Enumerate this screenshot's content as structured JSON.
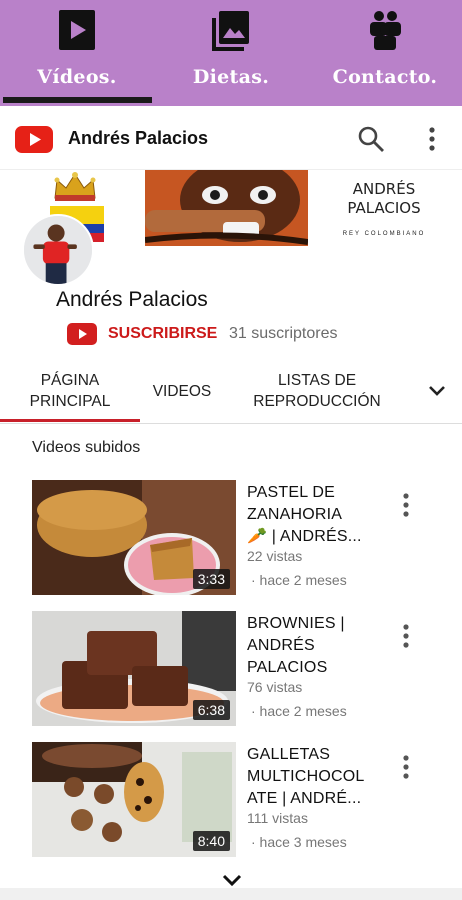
{
  "app_tabs": [
    {
      "label": "Vídeos.",
      "icon": "play-icon",
      "selected": true
    },
    {
      "label": "Dietas.",
      "icon": "image-gallery-icon",
      "selected": false
    },
    {
      "label": "Contacto.",
      "icon": "people-icon",
      "selected": false
    }
  ],
  "youtube_header": {
    "logo": "youtube-logo-icon",
    "title": "Andrés Palacios",
    "search_icon": "search-icon",
    "menu_icon": "more-vert-icon"
  },
  "banner": {
    "name_line1": "ANDRÉS",
    "name_line2": "PALACIOS",
    "tagline": "REY COLOMBIANO"
  },
  "channel": {
    "name": "Andrés Palacios",
    "subscribe_label": "SUSCRIBIRSE",
    "subscribers": "31 suscriptores"
  },
  "channel_tabs": [
    {
      "label_line1": "PÁGINA",
      "label_line2": "PRINCIPAL",
      "selected": true
    },
    {
      "label_line1": "VIDEOS",
      "label_line2": "",
      "selected": false
    },
    {
      "label_line1": "LISTAS DE",
      "label_line2": "REPRODUCCIÓN",
      "selected": false
    }
  ],
  "section_title": "Videos subidos",
  "videos": [
    {
      "title_l1": "PASTEL DE",
      "title_l2": "ZANAHORIA",
      "title_l3": "🥕 | ANDRÉS...",
      "views": "22 vistas",
      "ago": "· hace 2 meses",
      "duration": "3:33"
    },
    {
      "title_l1": "BROWNIES |",
      "title_l2": "ANDRÉS",
      "title_l3": "PALACIOS",
      "views": "76 vistas",
      "ago": "· hace 2 meses",
      "duration": "6:38"
    },
    {
      "title_l1": "GALLETAS",
      "title_l2": "MULTICHOCOL",
      "title_l3": "ATE | ANDRÉ...",
      "views": "111 vistas",
      "ago": "· hace 3 meses",
      "duration": "8:40"
    }
  ],
  "colors": {
    "app_bar": "#b981c9",
    "youtube_red": "#e62117",
    "subscribe_text": "#cc1a1a",
    "tab_underline": "#c8202a"
  }
}
